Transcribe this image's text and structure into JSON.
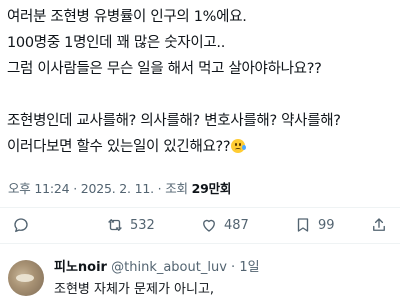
{
  "post": {
    "lines": [
      "여러분 조현병 유병률이 인구의 1%에요.",
      "100명중 1명인데 꽤 많은 숫자이고..",
      "그럼 이사람들은 무슨 일을 해서 먹고 살아야하나요??",
      "조현병인데 교사를해? 의사를해? 변호사를해? 약사를해?",
      "이러다보면 할수 있는일이 있긴해요??"
    ],
    "emoji": "crying-face-emoji"
  },
  "meta": {
    "time": "오후 11:24",
    "separator": "·",
    "date": "2025. 2. 11.",
    "views_label": "조회",
    "views_count": "29만회"
  },
  "actions": {
    "reply_count": "",
    "retweet_count": "532",
    "like_count": "487",
    "bookmark_count": "99"
  },
  "reply": {
    "name": "피노noir",
    "handle": "@think_about_luv",
    "separator": "·",
    "age": "1일",
    "text": "조현병 자체가 문제가 아니고,"
  },
  "colors": {
    "text": "#0f1419",
    "muted": "#536471",
    "divider": "#eff3f4"
  }
}
